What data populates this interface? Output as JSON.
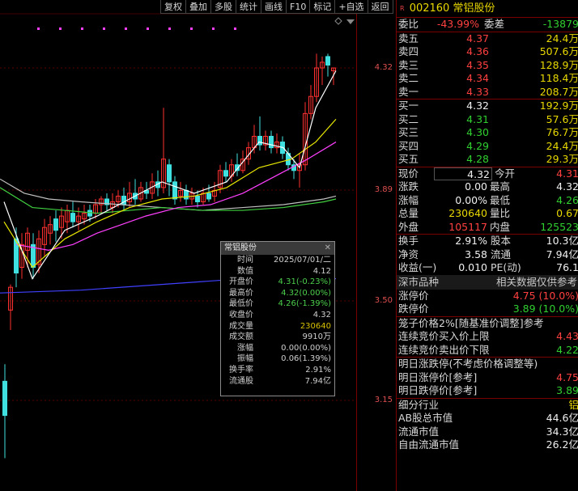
{
  "toolbar": [
    "复权",
    "叠加",
    "多股",
    "统计",
    "画线",
    "F10",
    "标记",
    "+自选",
    "返回"
  ],
  "chart": {
    "price_labels": [
      "4.32",
      "3.89",
      "3.50",
      "3.15"
    ],
    "colors": {
      "up": "#ff3030",
      "down": "#40e0e0",
      "ma5": "#ffffff",
      "ma10": "#e8e800",
      "ma20": "#ff40ff",
      "ma60": "#40d040",
      "ma120": "#c0c0c0",
      "ma250": "#4040ff"
    }
  },
  "tooltip": {
    "title": "常铝股份",
    "rows": [
      {
        "k": "时间",
        "v": "2025/07/01/二"
      },
      {
        "k": "数值",
        "v": "4.12"
      },
      {
        "k": "开盘价",
        "v": "4.31(-0.23%)"
      },
      {
        "k": "最高价",
        "v": "4.32(0.00%)"
      },
      {
        "k": "最低价",
        "v": "4.26(-1.39%)"
      },
      {
        "k": "收盘价",
        "v": "4.32"
      },
      {
        "k": "成交量",
        "v": "230640"
      },
      {
        "k": "成交额",
        "v": "9910万"
      },
      {
        "k": "涨幅",
        "v": "0.00(0.00%)"
      },
      {
        "k": "振幅",
        "v": "0.06(1.39%)"
      },
      {
        "k": "换手率",
        "v": "2.91%"
      },
      {
        "k": "流通股",
        "v": "7.94亿"
      }
    ]
  },
  "panel": {
    "code": "002160",
    "name": "常铝股份",
    "weibi": {
      "label": "委比",
      "value": "-43.99%",
      "label2": "委差",
      "value2": "-13879"
    },
    "sell": [
      {
        "label": "卖五",
        "price": "4.37",
        "vol": "24.4万"
      },
      {
        "label": "卖四",
        "price": "4.36",
        "vol": "507.6万"
      },
      {
        "label": "卖三",
        "price": "4.35",
        "vol": "128.9万"
      },
      {
        "label": "卖二",
        "price": "4.34",
        "vol": "118.4万"
      },
      {
        "label": "卖一",
        "price": "4.33",
        "vol": "208.7万"
      }
    ],
    "buy": [
      {
        "label": "买一",
        "price": "4.32",
        "vol": "192.9万"
      },
      {
        "label": "买二",
        "price": "4.31",
        "vol": "57.6万"
      },
      {
        "label": "买三",
        "price": "4.30",
        "vol": "76.7万"
      },
      {
        "label": "买四",
        "price": "4.29",
        "vol": "24.4万"
      },
      {
        "label": "买五",
        "price": "4.28",
        "vol": "29.3万"
      }
    ],
    "quote": [
      {
        "l1": "现价",
        "v1": "4.32",
        "c1": "white",
        "l2": "今开",
        "v2": "4.31",
        "c2": "red"
      },
      {
        "l1": "涨跌",
        "v1": "0.00",
        "c1": "white",
        "l2": "最高",
        "v2": "4.32",
        "c2": "white"
      },
      {
        "l1": "涨幅",
        "v1": "0.00%",
        "c1": "white",
        "l2": "最低",
        "v2": "4.26",
        "c2": "green"
      },
      {
        "l1": "总量",
        "v1": "230640",
        "c1": "yellow",
        "l2": "量比",
        "v2": "0.67",
        "c2": "yellow"
      },
      {
        "l1": "外盘",
        "v1": "105117",
        "c1": "red",
        "l2": "内盘",
        "v2": "125523",
        "c2": "green"
      }
    ],
    "fund": [
      {
        "l1": "换手",
        "v1": "2.91%",
        "l2": "股本",
        "v2": "10.3亿"
      },
      {
        "l1": "净资",
        "v1": "3.58",
        "l2": "流通",
        "v2": "7.94亿"
      },
      {
        "l1": "收益(一)",
        "v1": "0.010",
        "l2": "PE(动)",
        "v2": "76.1"
      }
    ],
    "market_hdr": {
      "left": "深市品种",
      "right": "相关数据仅供参考"
    },
    "limit": [
      {
        "l": "涨停价",
        "v": "4.75 (10.0%)",
        "c": "red"
      },
      {
        "l": "跌停价",
        "v": "3.89 (10.0%)",
        "c": "green"
      }
    ],
    "cage": {
      "title": "笼子价格2%[随基准价调整]参考",
      "rows": [
        {
          "l": "连续竞价买入价上限",
          "v": "4.43",
          "c": "red"
        },
        {
          "l": "连续竞价卖出价下限",
          "v": "4.22",
          "c": "green"
        }
      ]
    },
    "tomorrow": {
      "title": "明日涨跌停(不考虑价格调整等)",
      "rows": [
        {
          "l": "明日涨停价[参考]",
          "v": "4.75",
          "c": "red"
        },
        {
          "l": "明日跌停价[参考]",
          "v": "3.89",
          "c": "green"
        }
      ]
    },
    "industry": [
      {
        "l": "细分行业",
        "v": "铝",
        "c": "yellow"
      },
      {
        "l": "AB股总市值",
        "v": "44.6亿",
        "c": "white"
      },
      {
        "l": "流通市值",
        "v": "34.3亿",
        "c": "white"
      },
      {
        "l": "自由流通市值",
        "v": "26.2亿",
        "c": "white"
      }
    ]
  }
}
